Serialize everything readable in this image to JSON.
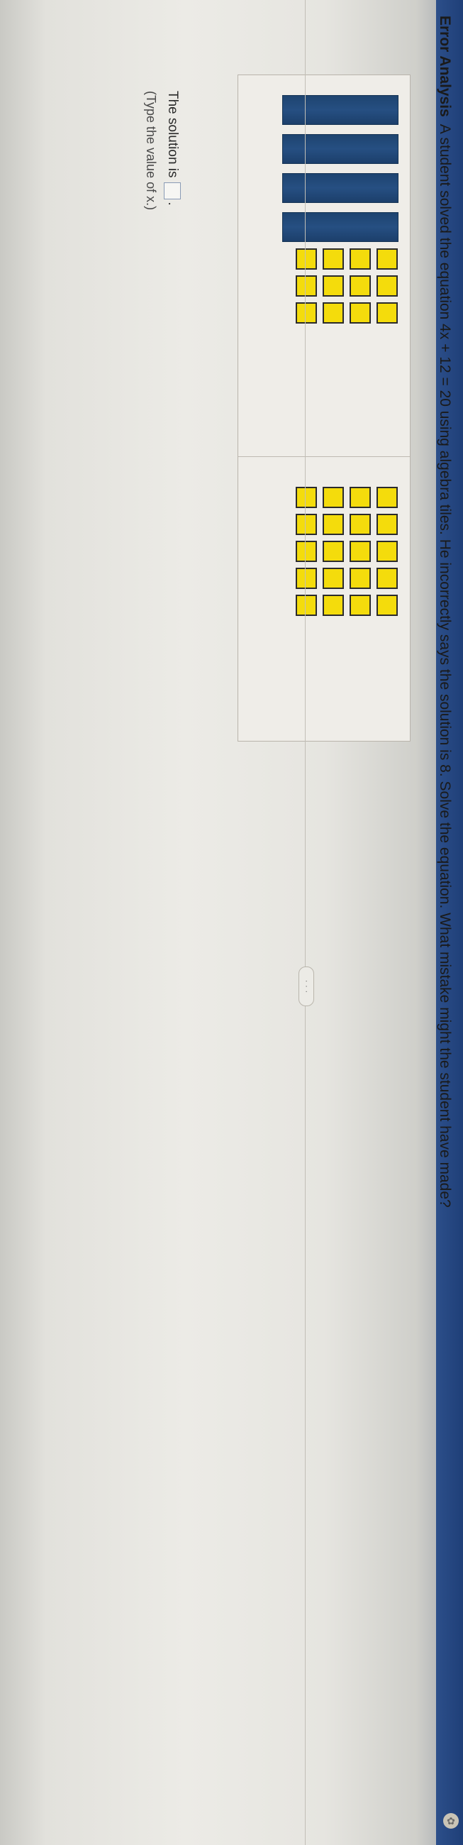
{
  "question": {
    "title": "Error Analysis",
    "text": "A student solved the equation 4x + 12 = 20 using algebra tiles. He incorrectly says the solution is 8. Solve the equation. What mistake might the student have made?"
  },
  "tiles": {
    "left_x_tiles": 4,
    "left_unit_tiles": 12,
    "right_unit_tiles": 20
  },
  "answer": {
    "prefix": "The solution is",
    "suffix": ".",
    "hint": "(Type the value of x.)"
  },
  "more_button": {
    "label": "· · ·"
  },
  "help_icon": {
    "glyph": "✿"
  },
  "colors": {
    "x_tile": "#234a7a",
    "unit_tile": "#f4dc0c",
    "side_strip": "#274a84"
  }
}
